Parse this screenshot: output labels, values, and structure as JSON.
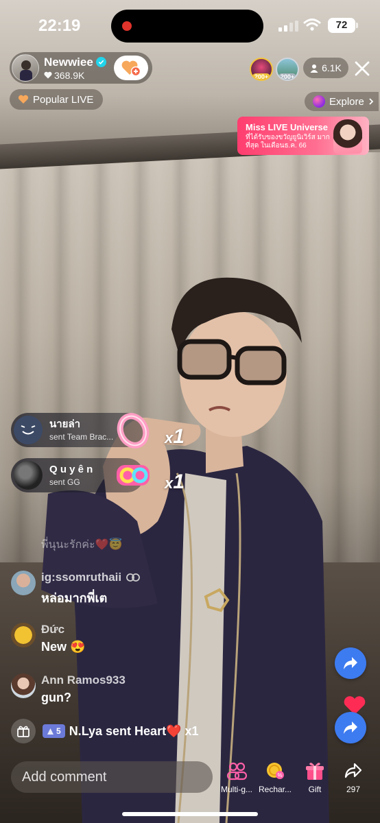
{
  "status_bar": {
    "time": "22:19",
    "battery": "72"
  },
  "host": {
    "name": "Newwiee",
    "likes": "368.9K"
  },
  "popular_live": "Popular LIVE",
  "top_viewers": [
    {
      "badge": "200+"
    },
    {
      "badge": "200+"
    }
  ],
  "viewer_count": "6.1K",
  "explore": "Explore",
  "banner": {
    "title": "Miss LIVE Universe",
    "subtitle": "ที่ได้รับของขวัญยูนิเวิร์ส มากที่สุด ในเดือนธ.ค. 66"
  },
  "gifts": [
    {
      "user": "นายล่า",
      "text": "sent Team Brac...",
      "count": "1"
    },
    {
      "user": "Q u y ê n",
      "text": "sent GG",
      "count": "1"
    }
  ],
  "faded_message": "พี่นุนะรักค่ะ❤️😇",
  "chat": [
    {
      "user": "ig:ssomruthaii",
      "text": "หล่อมากพี่เต"
    },
    {
      "user": "Đức",
      "text": "New 😍"
    },
    {
      "user": "Ann Ramos933",
      "text": "gun?"
    }
  ],
  "gift_bar": {
    "level": "5",
    "text": "N.Lya sent Heart❤️ x1"
  },
  "comment_placeholder": "Add comment",
  "bottom_actions": [
    {
      "label": "Multi-g..."
    },
    {
      "label": "Rechar..."
    },
    {
      "label": "Gift"
    },
    {
      "label": "297"
    }
  ],
  "colors": {
    "accent_pink": "#fe2c55",
    "share_blue": "#3d7bf0",
    "verified": "#20d5ec",
    "gold": "#f3c53b"
  }
}
